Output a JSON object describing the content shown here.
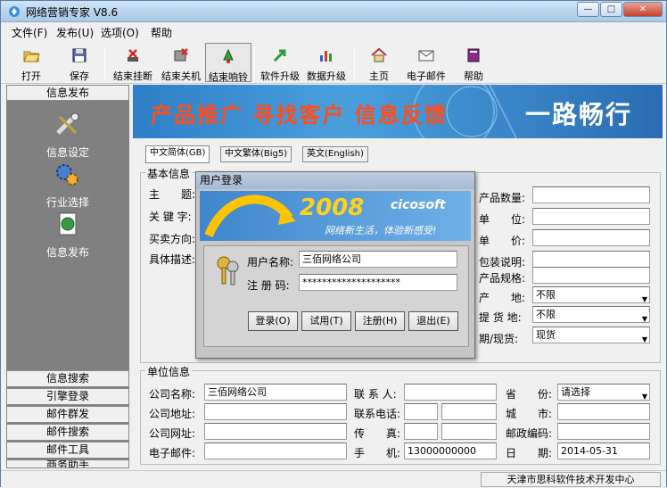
{
  "window": {
    "title": "网络营销专家 V8.6"
  },
  "menu": [
    "文件(F)",
    "发布(U)",
    "选项(O)",
    "帮助"
  ],
  "toolbar": [
    {
      "label": "打开",
      "icon": "folder-open-icon"
    },
    {
      "label": "保存",
      "icon": "floppy-disk-icon"
    },
    {
      "label": "结束挂断",
      "icon": "hangup-icon"
    },
    {
      "label": "结束关机",
      "icon": "shutdown-icon"
    },
    {
      "label": "结束响铃",
      "icon": "bell-icon"
    },
    {
      "label": "软件升级",
      "icon": "upgrade-arrow-icon"
    },
    {
      "label": "数据升级",
      "icon": "bar-chart-icon"
    },
    {
      "label": "主页",
      "icon": "home-icon"
    },
    {
      "label": "电子邮件",
      "icon": "email-icon"
    },
    {
      "label": "帮助",
      "icon": "help-book-icon"
    }
  ],
  "sidebar": {
    "header": "信息发布",
    "items": [
      "信息设定",
      "行业选择",
      "信息发布"
    ],
    "bottom": [
      "信息搜索",
      "引擎登录",
      "邮件群发",
      "邮件搜索",
      "邮件工具",
      "商务助手"
    ]
  },
  "banner": {
    "left": "产品推广 寻找客户 信息反馈",
    "right": "一路畅行"
  },
  "tabs": [
    "中文简体(GB)",
    "中文繁体(Big5)",
    "英文(English)"
  ],
  "basic": {
    "group": "基本信息",
    "left_labels": [
      "主　　题:",
      "关 键 字:",
      "买卖方向:",
      "具体描述:"
    ],
    "right_labels": [
      "产品数量:",
      "单　　位:",
      "单　　价:",
      "包装说明:",
      "产品规格:",
      "产　　地:",
      "提 货 地:",
      "期/现货:"
    ],
    "origin": "不限",
    "pickup": "不限",
    "spot": "现货"
  },
  "unit": {
    "group": "单位信息",
    "company_label": "公司名称:",
    "company": "三佰网络公司",
    "address_label": "公司地址:",
    "website_label": "公司网址:",
    "email_label": "电子邮件:",
    "contact_label": "联 系 人:",
    "phone_label": "联系电话:",
    "fax_label": "传　　真:",
    "mobile_label": "手　　机:",
    "mobile": "13000000000",
    "province_label": "省　　份:",
    "province": "请选择",
    "city_label": "城　　市:",
    "zip_label": "邮政编码:",
    "date_label": "日　　期:",
    "date": "2014-05-31"
  },
  "status": "天津市思科软件技术开发中心",
  "login": {
    "title": "用户登录",
    "banner_year": "2008",
    "banner_brand": "cicosoft",
    "banner_slogan": "网络新生活，体验新感受!",
    "user_label": "用户名称:",
    "user": "三佰网络公司",
    "code_label": "注 册 码:",
    "code": "********************",
    "buttons": [
      "登录(O)",
      "试用(T)",
      "注册(H)",
      "退出(E)"
    ]
  }
}
